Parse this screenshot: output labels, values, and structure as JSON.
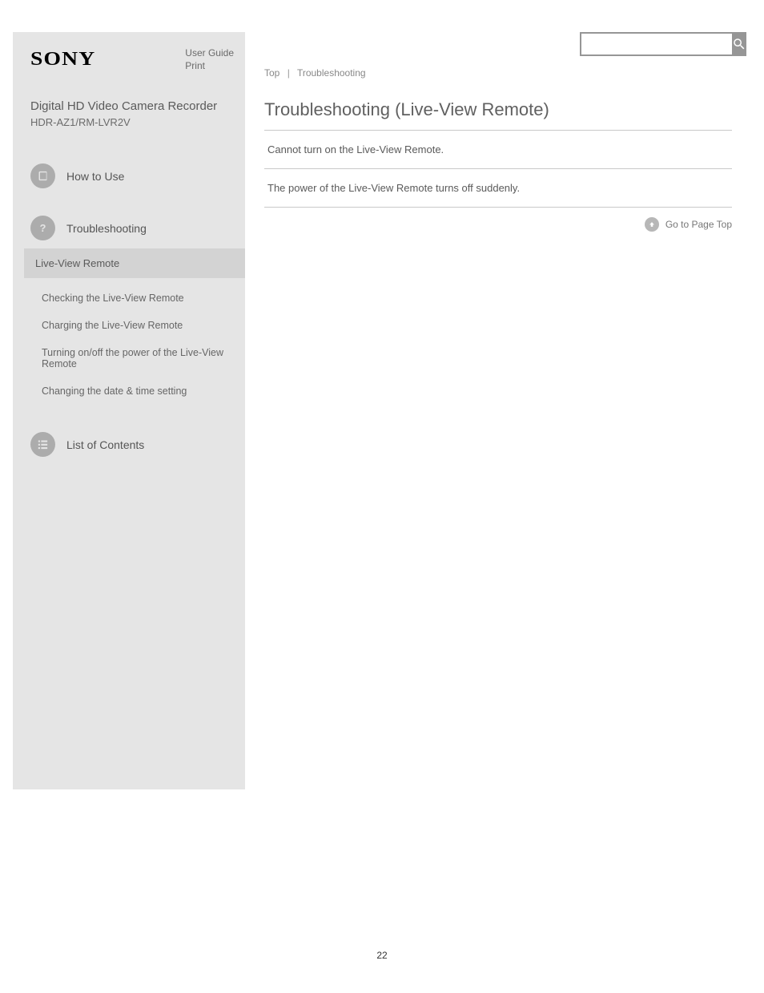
{
  "header": {
    "brand": "SONY",
    "side_link_1": "User Guide",
    "side_link_2": "Print",
    "product_title": "Digital HD Video Camera Recorder",
    "model": "HDR-AZ1/RM-LVR2V"
  },
  "sidebar": {
    "how_to_use": "How to Use",
    "troubleshooting": "Troubleshooting",
    "current_section": "Live-View Remote",
    "items": [
      "Checking the Live-View Remote",
      "Charging the Live-View Remote",
      "Turning on/off the power of the Live-View Remote",
      "Changing the date & time setting"
    ],
    "contents_list": "List of Contents"
  },
  "content": {
    "breadcrumb": {
      "a": "Top",
      "b": "Troubleshooting"
    },
    "heading": "Troubleshooting (Live-View Remote)",
    "links": [
      "Cannot turn on the Live-View Remote.",
      "The power of the Live-View Remote turns off suddenly."
    ],
    "to_top": "Go to Page Top"
  },
  "page_number": "22"
}
